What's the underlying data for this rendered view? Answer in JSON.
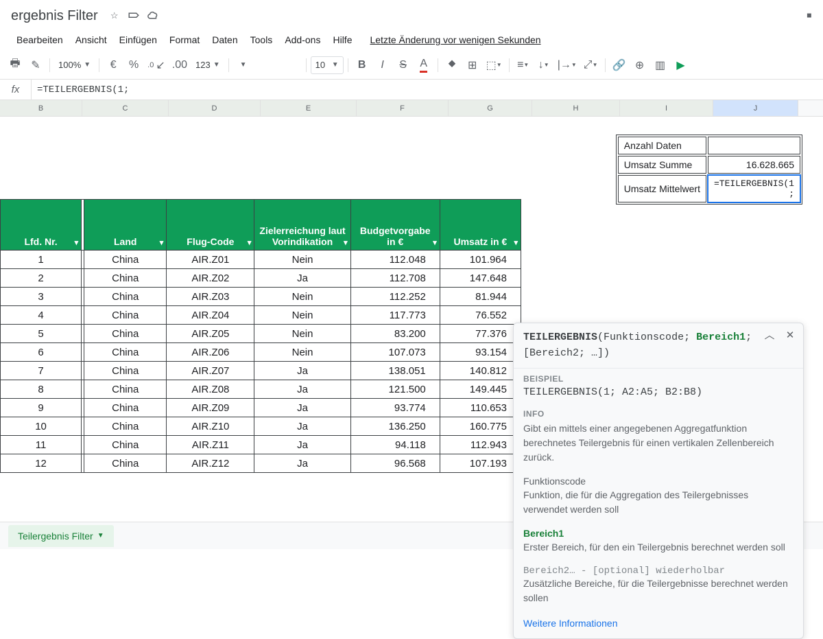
{
  "doc": {
    "title": "ergebnis Filter"
  },
  "menu": {
    "items": [
      "Bearbeiten",
      "Ansicht",
      "Einfügen",
      "Format",
      "Daten",
      "Tools",
      "Add-ons",
      "Hilfe"
    ],
    "last_edit": "Letzte Änderung vor wenigen Sekunden"
  },
  "toolbar": {
    "zoom": "100%",
    "currency": "€",
    "percent": "%",
    "dec_dec": ".0",
    "inc_dec": ".00",
    "num_fmt": "123",
    "font_size": "10"
  },
  "formula": {
    "value": "=TEILERGEBNIS(1;"
  },
  "cols": [
    "B",
    "C",
    "D",
    "E",
    "F",
    "G",
    "H",
    "I",
    "J"
  ],
  "side": {
    "rows": [
      {
        "label": "Anzahl Daten",
        "value": ""
      },
      {
        "label": "Umsatz Summe",
        "value": "16.628.665"
      },
      {
        "label": "Umsatz Mittelwert",
        "value": "=TEILERGEBNIS(1 ;"
      }
    ]
  },
  "table": {
    "headers": [
      "Lfd. Nr.",
      "Land",
      "Flug-Code",
      "Zielerreichung laut Vorindikation",
      "Budgetvorgabe in €",
      "Umsatz in €"
    ],
    "rows": [
      {
        "n": "1",
        "land": "China",
        "code": "AIR.Z01",
        "ziel": "Nein",
        "budget": "112.048",
        "umsatz": "101.964"
      },
      {
        "n": "2",
        "land": "China",
        "code": "AIR.Z02",
        "ziel": "Ja",
        "budget": "112.708",
        "umsatz": "147.648"
      },
      {
        "n": "3",
        "land": "China",
        "code": "AIR.Z03",
        "ziel": "Nein",
        "budget": "112.252",
        "umsatz": "81.944"
      },
      {
        "n": "4",
        "land": "China",
        "code": "AIR.Z04",
        "ziel": "Nein",
        "budget": "117.773",
        "umsatz": "76.552"
      },
      {
        "n": "5",
        "land": "China",
        "code": "AIR.Z05",
        "ziel": "Nein",
        "budget": "83.200",
        "umsatz": "77.376"
      },
      {
        "n": "6",
        "land": "China",
        "code": "AIR.Z06",
        "ziel": "Nein",
        "budget": "107.073",
        "umsatz": "93.154"
      },
      {
        "n": "7",
        "land": "China",
        "code": "AIR.Z07",
        "ziel": "Ja",
        "budget": "138.051",
        "umsatz": "140.812"
      },
      {
        "n": "8",
        "land": "China",
        "code": "AIR.Z08",
        "ziel": "Ja",
        "budget": "121.500",
        "umsatz": "149.445"
      },
      {
        "n": "9",
        "land": "China",
        "code": "AIR.Z09",
        "ziel": "Ja",
        "budget": "93.774",
        "umsatz": "110.653"
      },
      {
        "n": "10",
        "land": "China",
        "code": "AIR.Z10",
        "ziel": "Ja",
        "budget": "136.250",
        "umsatz": "160.775"
      },
      {
        "n": "11",
        "land": "China",
        "code": "AIR.Z11",
        "ziel": "Ja",
        "budget": "94.118",
        "umsatz": "112.943"
      },
      {
        "n": "12",
        "land": "China",
        "code": "AIR.Z12",
        "ziel": "Ja",
        "budget": "96.568",
        "umsatz": "107.193"
      }
    ]
  },
  "help": {
    "fn": "TEILERGEBNIS",
    "sig_open": "(",
    "arg1": "Funktionscode",
    "sep": "; ",
    "arg2": "Bereich1",
    "tail": "; [Bereich2; …])",
    "example_label": "BEISPIEL",
    "example": "TEILERGEBNIS(1; A2:A5; B2:B8)",
    "info_label": "INFO",
    "info": "Gibt ein mittels einer angegebenen Aggregatfunktion berechnetes Teilergebnis für einen vertikalen Zellenbereich zurück.",
    "p1": "Funktionscode",
    "p1d": "Funktion, die für die Aggregation des Teilergebnisses verwendet werden soll",
    "p2": "Bereich1",
    "p2d": "Erster Bereich, für den ein Teilergebnis berechnet werden soll",
    "p3": "Bereich2… - [optional] wiederholbar",
    "p3d": "Zusätzliche Bereiche, für die Teilergebnisse berechnet werden sollen",
    "more": "Weitere Informationen"
  },
  "tab": {
    "name": "Teilergebnis Filter"
  }
}
